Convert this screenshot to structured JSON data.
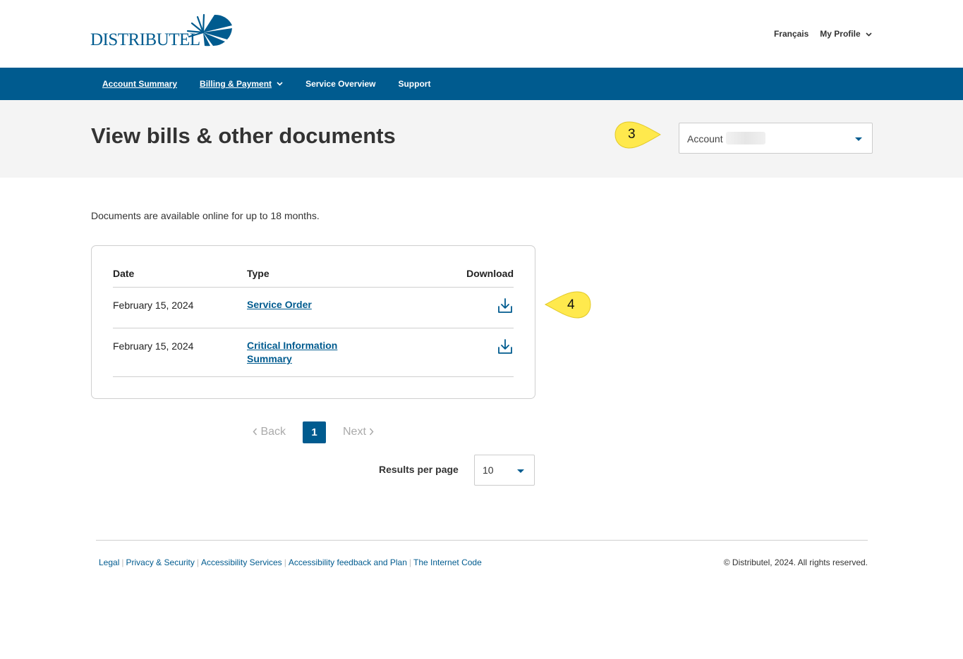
{
  "header": {
    "logo_text": "DISTRIBUTEL",
    "language_link": "Français",
    "profile_menu": "My Profile"
  },
  "nav": {
    "items": [
      {
        "label": "Account Summary"
      },
      {
        "label": "Billing & Payment"
      },
      {
        "label": "Service Overview"
      },
      {
        "label": "Support"
      }
    ]
  },
  "page": {
    "title": "View bills & other documents",
    "account_select": {
      "label": "Account"
    },
    "callouts": [
      "3",
      "4"
    ]
  },
  "content": {
    "note": "Documents are available online for up to 18 months.",
    "table": {
      "columns": [
        "Date",
        "Type",
        "Download"
      ],
      "rows": [
        {
          "date": "February 15, 2024",
          "type_line1": "Service Order",
          "type_line2": ""
        },
        {
          "date": "February 15, 2024",
          "type_line1": "Critical Information",
          "type_line2": "Summary"
        }
      ]
    },
    "pagination": {
      "back": "Back",
      "current": "1",
      "next": "Next",
      "results_label": "Results per page",
      "results_value": "10"
    }
  },
  "footer": {
    "links": [
      "Legal",
      "Privacy & Security",
      "Accessibility Services",
      "Accessibility feedback and Plan",
      "The Internet Code"
    ],
    "copyright": "© Distributel, 2024. All rights reserved."
  },
  "colors": {
    "brand_blue": "#005b8f",
    "callout_yellow": "#ffe94d",
    "band_gray": "#f4f4f4"
  }
}
